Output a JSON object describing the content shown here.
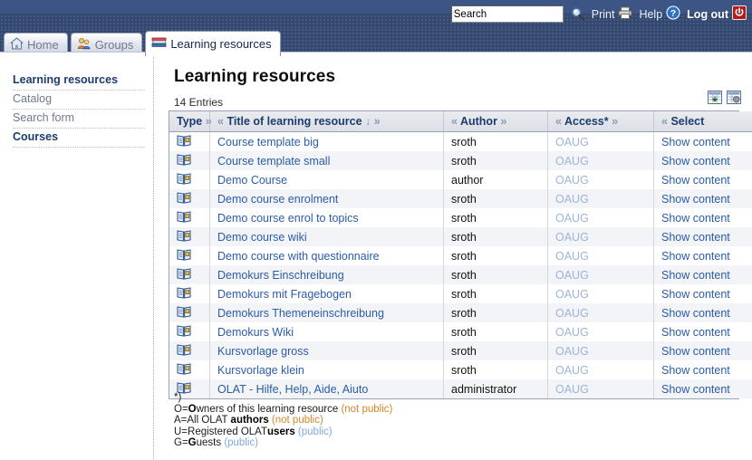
{
  "topbar": {
    "search": {
      "value": "Search",
      "placeholder": "Search"
    },
    "search_icon": "magnifier-icon",
    "print_label": "Print",
    "print_icon": "printer-icon",
    "help_label": "Help",
    "help_icon": "question-mark-icon",
    "logout_label": "Log out",
    "logout_icon": "power-icon"
  },
  "tabs": [
    {
      "label": "Home",
      "icon": "house-icon",
      "active": false
    },
    {
      "label": "Groups",
      "icon": "people-icon",
      "active": false
    },
    {
      "label": "Learning resources",
      "icon": "books-icon",
      "active": true
    }
  ],
  "sidebar": {
    "items": [
      {
        "label": "Learning resources",
        "style": "head"
      },
      {
        "label": "Catalog",
        "style": "link"
      },
      {
        "label": "Search form",
        "style": "link"
      },
      {
        "label": "Courses",
        "style": "sel"
      }
    ]
  },
  "main": {
    "title": "Learning resources",
    "entries": "14 Entries",
    "tools": [
      {
        "name": "table-download-icon",
        "title": "Download table"
      },
      {
        "name": "table-settings-icon",
        "title": "Table settings"
      }
    ],
    "table": {
      "columns": [
        {
          "key": "type",
          "label": "Type",
          "pre": "",
          "post": "»",
          "sorted": false
        },
        {
          "key": "title",
          "label": "Title of learning resource",
          "pre": "«",
          "post": "↓ »",
          "sorted": true
        },
        {
          "key": "author",
          "label": "Author",
          "pre": "«",
          "post": "»",
          "sorted": false
        },
        {
          "key": "access",
          "label": "Access*",
          "pre": "«",
          "post": "»",
          "sorted": false
        },
        {
          "key": "select",
          "label": "Select",
          "pre": "«",
          "post": "",
          "sorted": false
        }
      ],
      "rows": [
        {
          "type_icon": "course-book-icon",
          "title": "Course template big",
          "author": "sroth",
          "access": "OAUG",
          "select": "Show content"
        },
        {
          "type_icon": "course-book-icon",
          "title": "Course template small",
          "author": "sroth",
          "access": "OAUG",
          "select": "Show content"
        },
        {
          "type_icon": "course-book-icon",
          "title": "Demo Course",
          "author": "author",
          "access": "OAUG",
          "select": "Show content"
        },
        {
          "type_icon": "course-book-icon",
          "title": "Demo course enrolment",
          "author": "sroth",
          "access": "OAUG",
          "select": "Show content"
        },
        {
          "type_icon": "course-book-icon",
          "title": "Demo course enrol to topics",
          "author": "sroth",
          "access": "OAUG",
          "select": "Show content"
        },
        {
          "type_icon": "course-book-icon",
          "title": "Demo course wiki",
          "author": "sroth",
          "access": "OAUG",
          "select": "Show content"
        },
        {
          "type_icon": "course-book-icon",
          "title": "Demo course with questionnaire",
          "author": "sroth",
          "access": "OAUG",
          "select": "Show content"
        },
        {
          "type_icon": "course-book-icon",
          "title": "Demokurs Einschreibung",
          "author": "sroth",
          "access": "OAUG",
          "select": "Show content"
        },
        {
          "type_icon": "course-book-icon",
          "title": "Demokurs mit Fragebogen",
          "author": "sroth",
          "access": "OAUG",
          "select": "Show content"
        },
        {
          "type_icon": "course-book-icon",
          "title": "Demokurs Themeneinschreibung",
          "author": "sroth",
          "access": "OAUG",
          "select": "Show content"
        },
        {
          "type_icon": "course-book-icon",
          "title": "Demokurs Wiki",
          "author": "sroth",
          "access": "OAUG",
          "select": "Show content"
        },
        {
          "type_icon": "course-book-icon",
          "title": "Kursvorlage gross",
          "author": "sroth",
          "access": "OAUG",
          "select": "Show content"
        },
        {
          "type_icon": "course-book-icon",
          "title": "Kursvorlage klein",
          "author": "sroth",
          "access": "OAUG",
          "select": "Show content"
        },
        {
          "type_icon": "course-book-icon",
          "title": "OLAT - Hilfe, Help, Aide, Aiuto",
          "author": "administrator",
          "access": "OAUG",
          "select": "Show content"
        }
      ]
    },
    "legend": {
      "marker": "*)",
      "lines": [
        {
          "code": "O=",
          "bold": "O",
          "rest": "wners of this learning resource ",
          "note": "(not public)",
          "note_style": "notpub"
        },
        {
          "code": "A=",
          "bold": "All OLAT ",
          "rest": "authors ",
          "note": "(not public)",
          "note_style": "notpub",
          "swap": true
        },
        {
          "code": "U=",
          "bold": "Registered OLAT",
          "rest": "users ",
          "note": "(public)",
          "note_style": "pub",
          "swap2": true
        },
        {
          "code": "G=",
          "bold": "G",
          "rest": "uests ",
          "note": "(public)",
          "note_style": "pub"
        }
      ]
    }
  },
  "colors": {
    "header_blue": "#364f79",
    "link_blue": "#2b5ca8",
    "access_blue": "#9db4d6",
    "not_public": "#d4862a",
    "public": "#7fa8dd",
    "logout_red": "#b01c1c"
  }
}
